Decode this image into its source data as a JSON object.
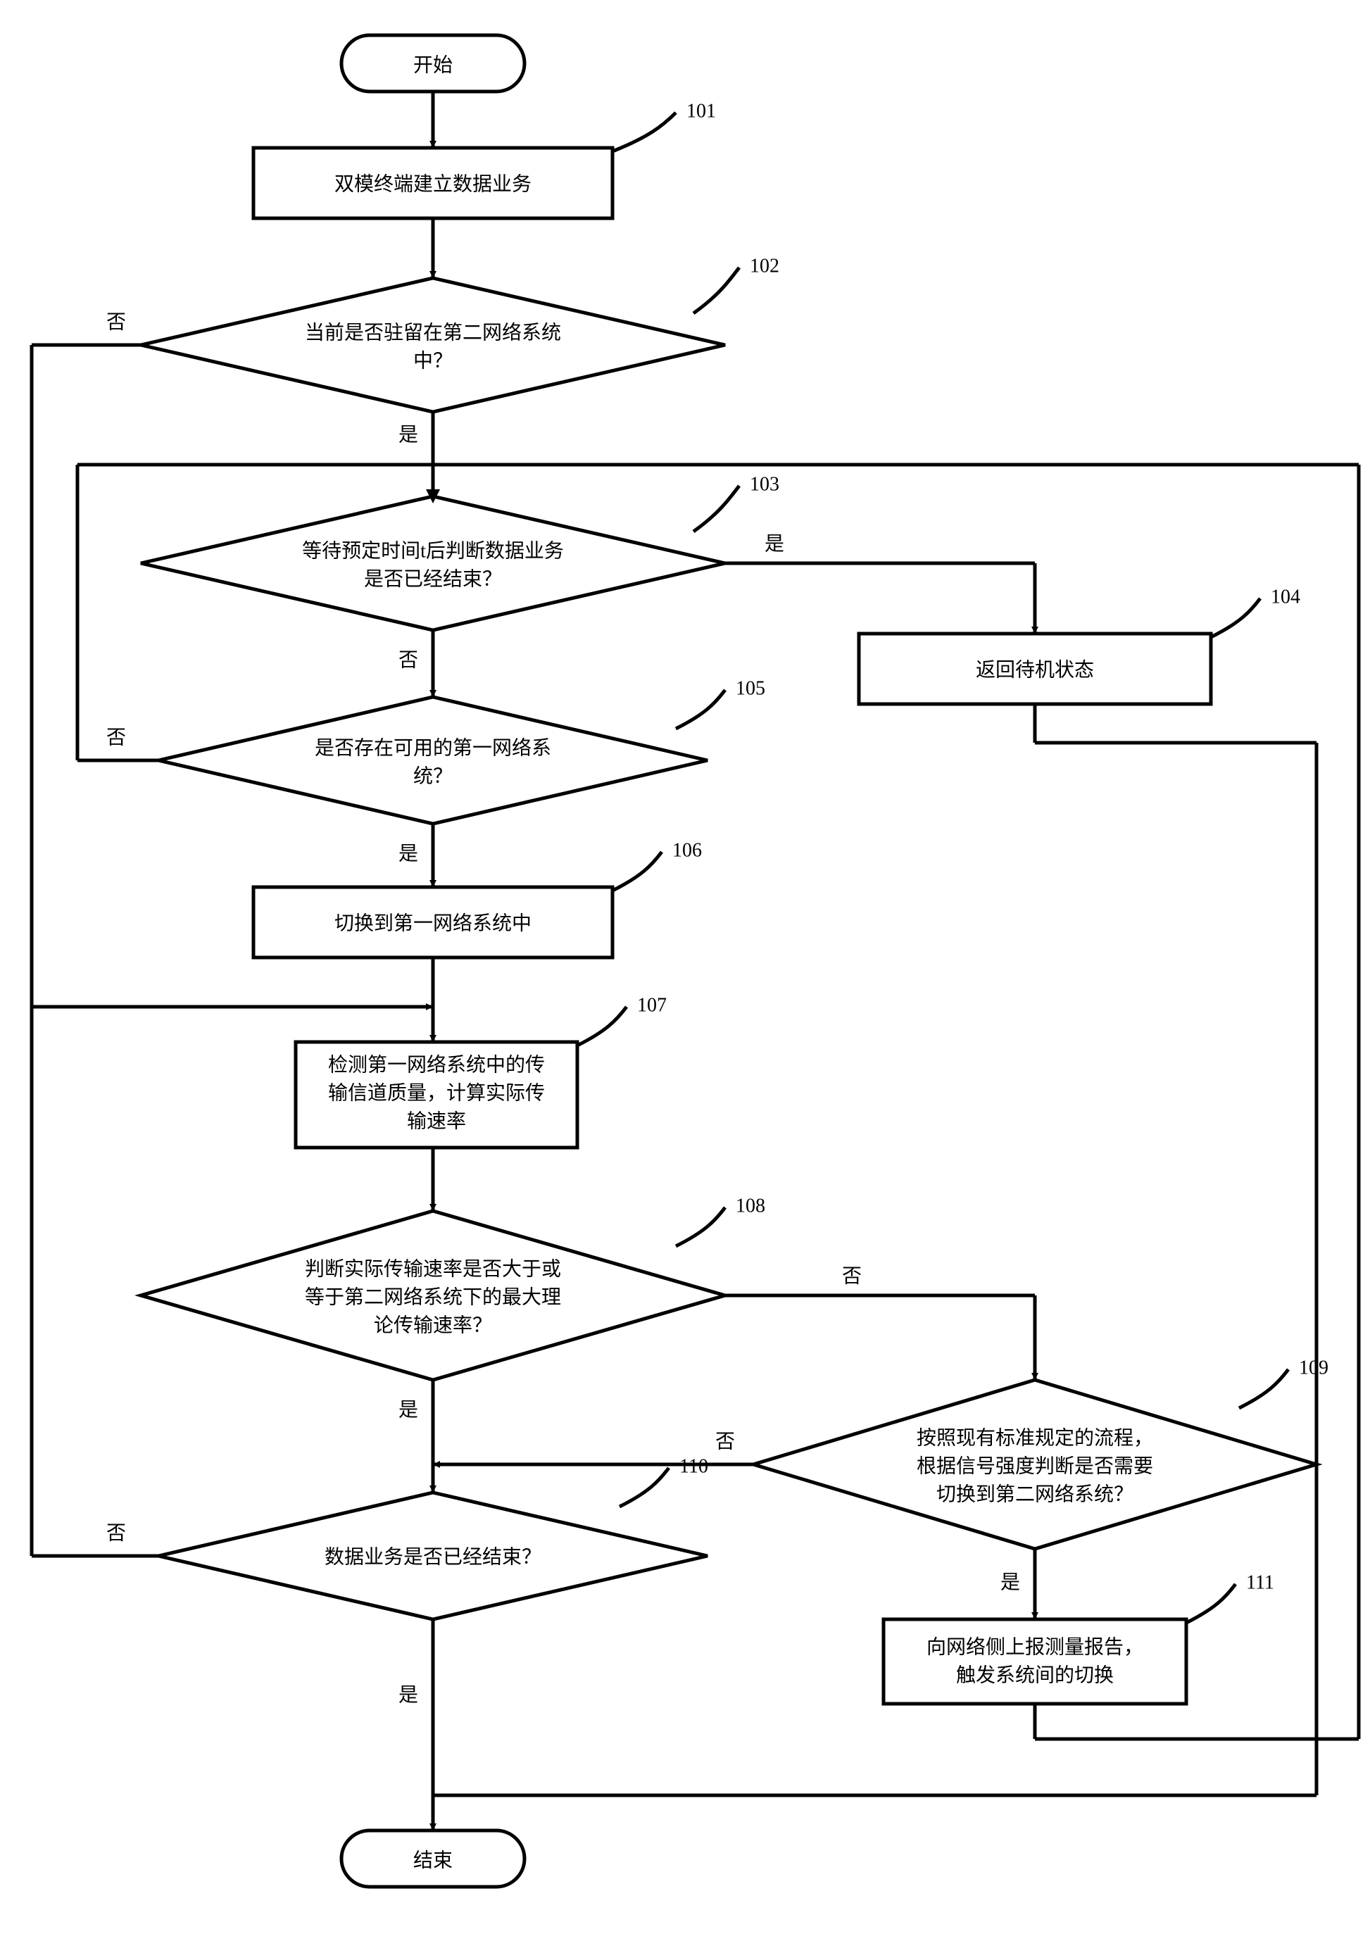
{
  "start": "开始",
  "end": "结束",
  "yes": "是",
  "no": "否",
  "n101": {
    "num": "101",
    "text": "双模终端建立数据业务"
  },
  "n102": {
    "num": "102",
    "l1": "当前是否驻留在第二网络系统",
    "l2": "中？"
  },
  "n103": {
    "num": "103",
    "l1": "等待预定时间t后判断数据业务",
    "l2": "是否已经结束？"
  },
  "n104": {
    "num": "104",
    "text": "返回待机状态"
  },
  "n105": {
    "num": "105",
    "l1": "是否存在可用的第一网络系",
    "l2": "统？"
  },
  "n106": {
    "num": "106",
    "text": "切换到第一网络系统中"
  },
  "n107": {
    "num": "107",
    "l1": "检测第一网络系统中的传",
    "l2": "输信道质量，计算实际传",
    "l3": "输速率"
  },
  "n108": {
    "num": "108",
    "l1": "判断实际传输速率是否大于或",
    "l2": "等于第二网络系统下的最大理",
    "l3": "论传输速率？"
  },
  "n109": {
    "num": "109",
    "l1": "按照现有标准规定的流程，",
    "l2": "根据信号强度判断是否需要",
    "l3": "切换到第二网络系统？"
  },
  "n110": {
    "num": "110",
    "text": "数据业务是否已经结束？"
  },
  "n111": {
    "num": "111",
    "l1": "向网络侧上报测量报告，",
    "l2": "触发系统间的切换"
  }
}
